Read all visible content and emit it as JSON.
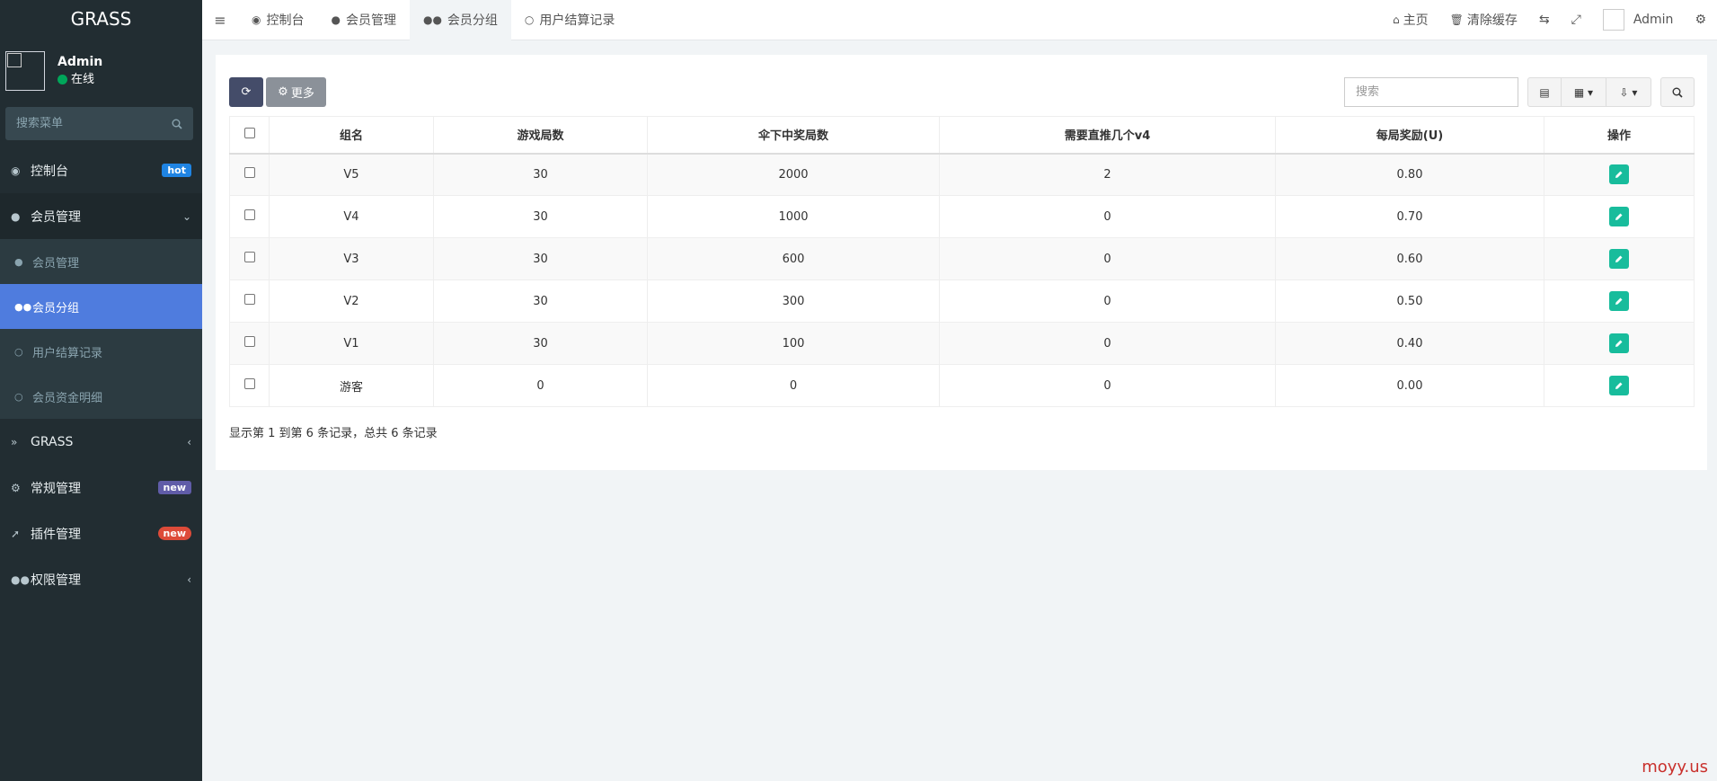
{
  "sidebar": {
    "logo": "GRASS",
    "user": {
      "name": "Admin",
      "status": "在线"
    },
    "search_placeholder": "搜索菜单",
    "items": [
      {
        "label": "控制台",
        "badge": "hot"
      },
      {
        "label": "会员管理"
      },
      {
        "label": "GRASS"
      },
      {
        "label": "常规管理",
        "badge": "new"
      },
      {
        "label": "插件管理",
        "badge": "new"
      },
      {
        "label": "权限管理"
      }
    ],
    "submenu": [
      {
        "label": "会员管理"
      },
      {
        "label": "会员分组"
      },
      {
        "label": "用户结算记录"
      },
      {
        "label": "会员资金明细"
      }
    ]
  },
  "navbar": {
    "tabs": [
      {
        "label": "控制台"
      },
      {
        "label": "会员管理"
      },
      {
        "label": "会员分组"
      },
      {
        "label": "用户结算记录"
      }
    ],
    "right": {
      "home": "主页",
      "clear_cache": "清除缓存",
      "user": "Admin"
    }
  },
  "toolbar": {
    "more_label": "更多",
    "search_placeholder": "搜索"
  },
  "table": {
    "headers": [
      "组名",
      "游戏局数",
      "伞下中奖局数",
      "需要直推几个v4",
      "每局奖励(U)",
      "操作"
    ],
    "rows": [
      [
        "V5",
        "30",
        "2000",
        "2",
        "0.80"
      ],
      [
        "V4",
        "30",
        "1000",
        "0",
        "0.70"
      ],
      [
        "V3",
        "30",
        "600",
        "0",
        "0.60"
      ],
      [
        "V2",
        "30",
        "300",
        "0",
        "0.50"
      ],
      [
        "V1",
        "30",
        "100",
        "0",
        "0.40"
      ],
      [
        "游客",
        "0",
        "0",
        "0",
        "0.00"
      ]
    ]
  },
  "pagination_text": "显示第 1 到第 6 条记录，总共 6 条记录",
  "watermark": "moyy.us",
  "colors": {
    "sidebar_bg": "#222d32",
    "active_item": "#4f7cde",
    "edit_button": "#18bc9c",
    "online": "#00a65a"
  }
}
